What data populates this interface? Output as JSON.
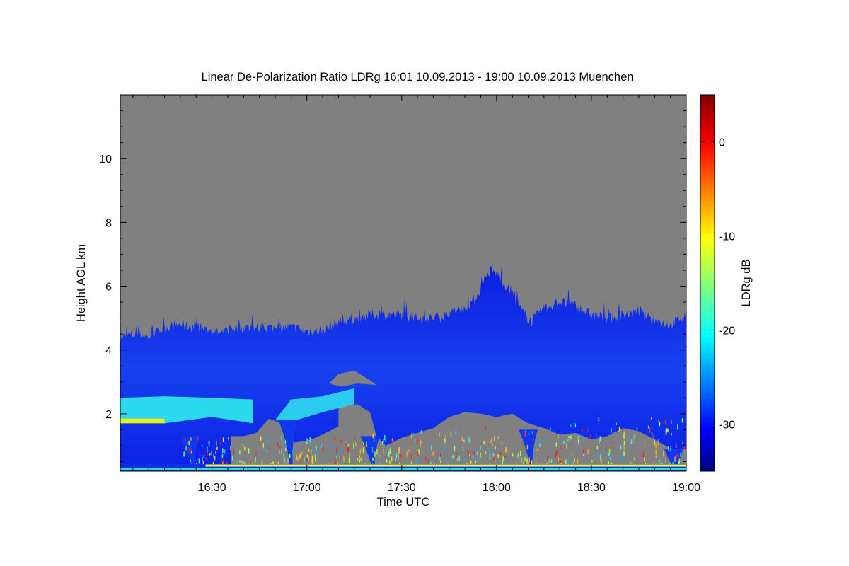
{
  "chart_data": {
    "type": "heatmap",
    "title": "Linear De-Polarization Ratio LDRg   16:01 10.09.2013 - 19:00 10.09.2013 Muenchen",
    "xlabel": "Time UTC",
    "ylabel": "Height AGL km",
    "x_range_minutes_utc": [
      961,
      1140
    ],
    "y_range_km": [
      0.2,
      12.0
    ],
    "x_ticks": [
      {
        "label": "16:30",
        "value": 990
      },
      {
        "label": "17:00",
        "value": 1020
      },
      {
        "label": "17:30",
        "value": 1050
      },
      {
        "label": "18:00",
        "value": 1080
      },
      {
        "label": "18:30",
        "value": 1110
      },
      {
        "label": "19:00",
        "value": 1140
      }
    ],
    "y_ticks": [
      {
        "label": "2",
        "value": 2
      },
      {
        "label": "4",
        "value": 4
      },
      {
        "label": "6",
        "value": 6
      },
      {
        "label": "8",
        "value": 8
      },
      {
        "label": "10",
        "value": 10
      }
    ],
    "colorbar": {
      "label": "LDRg dB",
      "range": [
        -35,
        5
      ],
      "ticks": [
        {
          "label": "0",
          "value": 0
        },
        {
          "label": "-10",
          "value": -10
        },
        {
          "label": "-20",
          "value": -20
        },
        {
          "label": "-30",
          "value": -30
        }
      ]
    },
    "no_data_color": "#808080",
    "cloud_top_profile_km": [
      [
        961,
        4.4
      ],
      [
        966,
        4.5
      ],
      [
        970,
        4.4
      ],
      [
        975,
        4.7
      ],
      [
        980,
        4.8
      ],
      [
        985,
        4.7
      ],
      [
        990,
        4.6
      ],
      [
        993,
        4.5
      ],
      [
        996,
        4.7
      ],
      [
        1000,
        4.7
      ],
      [
        1005,
        4.7
      ],
      [
        1010,
        4.7
      ],
      [
        1015,
        4.7
      ],
      [
        1020,
        4.6
      ],
      [
        1025,
        4.6
      ],
      [
        1030,
        4.9
      ],
      [
        1035,
        5.0
      ],
      [
        1040,
        5.1
      ],
      [
        1045,
        5.1
      ],
      [
        1050,
        5.1
      ],
      [
        1055,
        5.0
      ],
      [
        1060,
        5.0
      ],
      [
        1065,
        5.1
      ],
      [
        1070,
        5.3
      ],
      [
        1073,
        5.6
      ],
      [
        1075,
        5.9
      ],
      [
        1078,
        6.5
      ],
      [
        1080,
        6.4
      ],
      [
        1083,
        6.0
      ],
      [
        1086,
        5.6
      ],
      [
        1088,
        5.2
      ],
      [
        1091,
        4.9
      ],
      [
        1095,
        5.3
      ],
      [
        1100,
        5.5
      ],
      [
        1105,
        5.4
      ],
      [
        1110,
        5.1
      ],
      [
        1115,
        5.0
      ],
      [
        1120,
        5.1
      ],
      [
        1125,
        5.2
      ],
      [
        1130,
        4.9
      ],
      [
        1135,
        4.8
      ],
      [
        1140,
        5.1
      ]
    ],
    "aerosol_layer": {
      "time_range": [
        961,
        1003
      ],
      "height_km": [
        1.6,
        2.5
      ],
      "ldr_db": -21
    },
    "aerosol_layer_2": {
      "time_range": [
        1010,
        1035
      ],
      "height_km": [
        1.8,
        2.8
      ],
      "ldr_db": -22
    },
    "cloud_ldr_db": -31
  }
}
